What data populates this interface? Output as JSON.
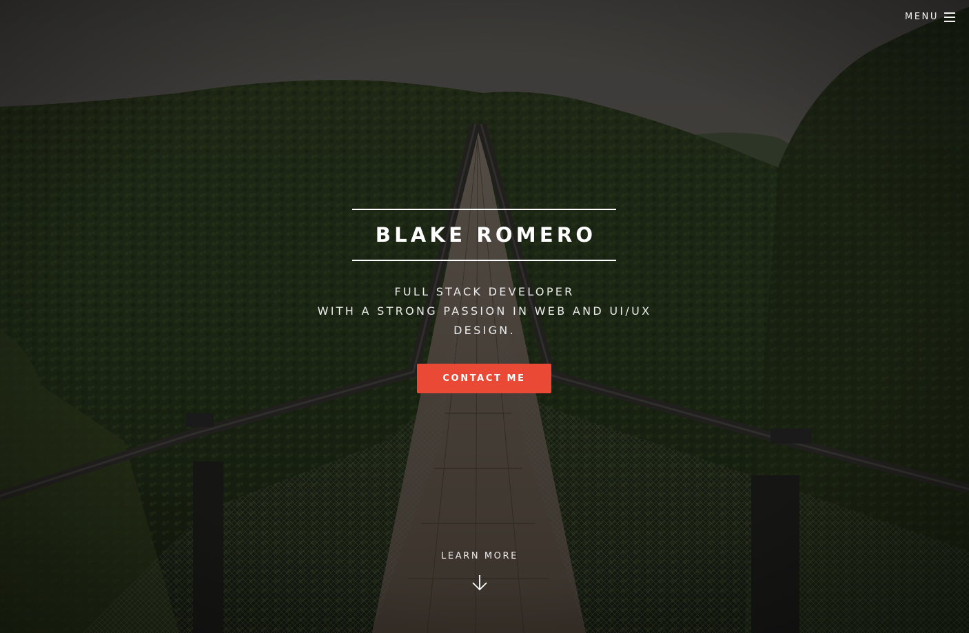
{
  "nav": {
    "menu_label": "MENU",
    "menu_icon": "hamburger-icon"
  },
  "hero": {
    "title": "BLAKE ROMERO",
    "subtitle_lines": [
      "FULL STACK DEVELOPER",
      "WITH A STRONG PASSION IN WEB AND UI/UX",
      "DESIGN."
    ],
    "cta_label": "CONTACT ME",
    "learn_more_label": "LEARN MORE",
    "learn_more_icon": "arrow-down-icon",
    "background_image": "forest suspension bridge"
  },
  "colors": {
    "accent": "#ea4a35",
    "text": "#ffffff"
  }
}
